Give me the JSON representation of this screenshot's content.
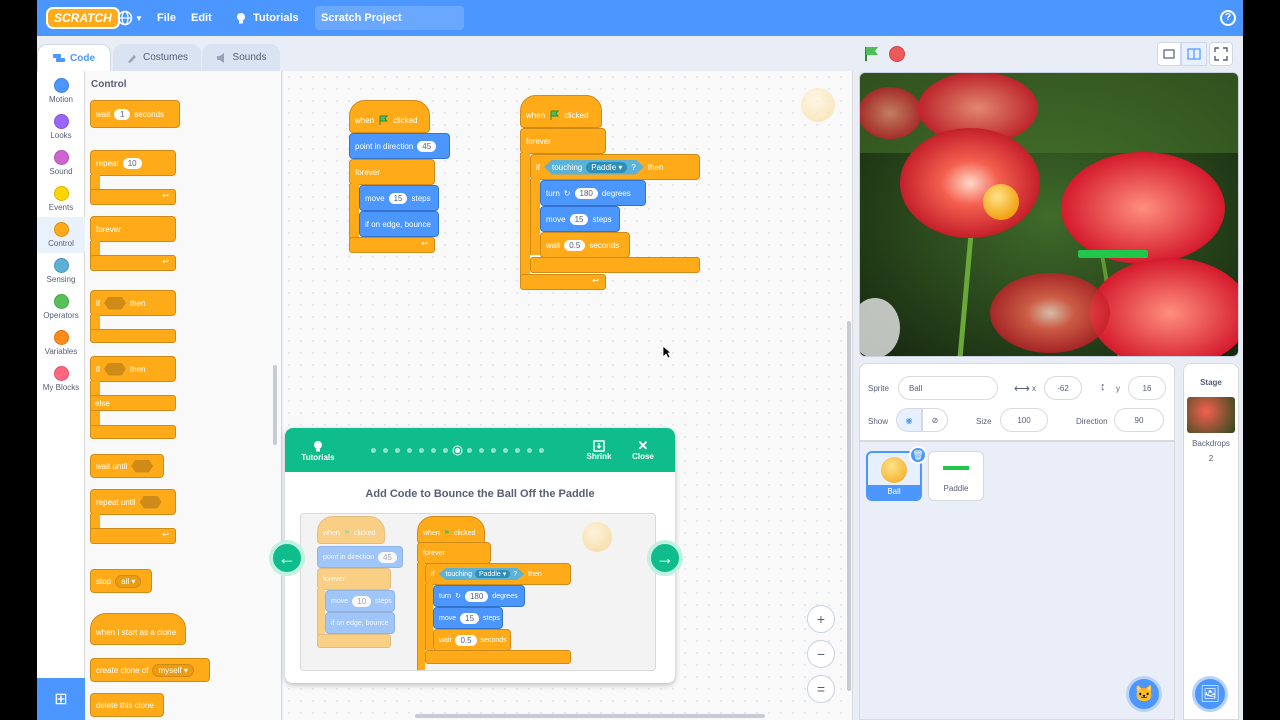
{
  "menubar": {
    "logo": "SCRATCH",
    "file": "File",
    "edit": "Edit",
    "tutorials": "Tutorials",
    "project_title": "Scratch Project",
    "help": "?"
  },
  "tabs": {
    "code": "Code",
    "costumes": "Costumes",
    "sounds": "Sounds"
  },
  "categories": [
    {
      "label": "Motion",
      "color": "#4c97ff"
    },
    {
      "label": "Looks",
      "color": "#9966ff"
    },
    {
      "label": "Sound",
      "color": "#cf63cf"
    },
    {
      "label": "Events",
      "color": "#ffd500"
    },
    {
      "label": "Control",
      "color": "#ffab19"
    },
    {
      "label": "Sensing",
      "color": "#5cb1d6"
    },
    {
      "label": "Operators",
      "color": "#59c059"
    },
    {
      "label": "Variables",
      "color": "#ff8c1a"
    },
    {
      "label": "My Blocks",
      "color": "#ff6680"
    }
  ],
  "palette": {
    "title": "Control",
    "wait": {
      "label": "wait",
      "value": "1",
      "unit": "seconds"
    },
    "repeat": {
      "label": "repeat",
      "value": "10"
    },
    "forever": "forever",
    "if_then": {
      "if": "if",
      "then": "then"
    },
    "if_else": {
      "if": "if",
      "then": "then",
      "else": "else"
    },
    "wait_until": "wait until",
    "repeat_until": "repeat until",
    "stop": {
      "label": "stop",
      "value": "all"
    },
    "start_clone": "when I start as a clone",
    "create_clone": {
      "label": "create clone of",
      "value": "myself"
    },
    "delete_clone": "delete this clone"
  },
  "script1": {
    "when": "when",
    "clicked": "clicked",
    "point": "point in direction",
    "direction": "45",
    "forever": "forever",
    "move": "move",
    "steps_value": "15",
    "steps": "steps",
    "bounce": "if on edge, bounce"
  },
  "script2": {
    "when": "when",
    "clicked": "clicked",
    "forever": "forever",
    "if": "if",
    "touching": "touching",
    "target": "Paddle",
    "q": "?",
    "then": "then",
    "turn": "turn",
    "turn_value": "180",
    "degrees": "degrees",
    "move": "move",
    "move_value": "15",
    "steps": "steps",
    "wait": "wait",
    "wait_value": "0.5",
    "seconds": "seconds"
  },
  "tutorial": {
    "tutorials": "Tutorials",
    "shrink": "Shrink",
    "close": "Close",
    "title": "Add Code to Bounce the Ball Off the Paddle",
    "step_total": 15,
    "step_current": 8,
    "img": {
      "when": "when",
      "clicked": "clicked",
      "point": "point in direction",
      "dir": "45",
      "forever": "forever",
      "move": "move",
      "mv1": "10",
      "steps": "steps",
      "bounce": "if on edge, bounce",
      "if": "if",
      "touching": "touching",
      "target": "Paddle",
      "q": "?",
      "then": "then",
      "turn": "turn",
      "turn_value": "180",
      "degrees": "degrees",
      "mv2": "15",
      "wait": "wait",
      "wait_value": "0.5",
      "seconds": "seconds"
    }
  },
  "zoom": {
    "in": "+",
    "out": "−",
    "reset": "="
  },
  "sprite_info": {
    "sprite_label": "Sprite",
    "sprite_name": "Ball",
    "x_label": "x",
    "x": "-62",
    "y_label": "y",
    "y": "16",
    "show_label": "Show",
    "size_label": "Size",
    "size": "100",
    "direction_label": "Direction",
    "direction": "90"
  },
  "sprites": [
    {
      "name": "Ball"
    },
    {
      "name": "Paddle"
    }
  ],
  "stage_panel": {
    "title": "Stage",
    "backdrops_label": "Backdrops",
    "backdrops_count": "2"
  }
}
